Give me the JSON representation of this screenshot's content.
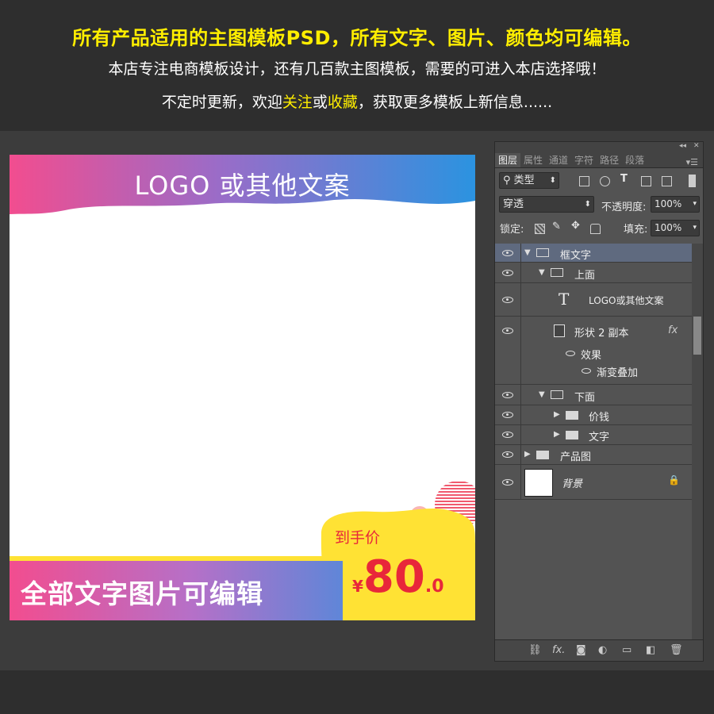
{
  "header": {
    "line1": "所有产品适用的主图模板PSD，所有文字、图片、颜色均可编辑。",
    "line2": "本店专注电商模板设计，还有几百款主图模板，需要的可进入本店选择哦！",
    "line3_pre": "不定时更新，欢迎",
    "line3_hl1": "关注",
    "line3_mid": "或",
    "line3_hl2": "收藏",
    "line3_post": "，获取更多模板上新信息......"
  },
  "canvas": {
    "logo_text": "LOGO 或其他文案",
    "edit_text": "全部文字图片可编辑",
    "price_label": "到手价",
    "currency": "¥",
    "price_int": "80",
    "price_dec": ".0"
  },
  "panel": {
    "tabs": [
      "图层",
      "属性",
      "通道",
      "字符",
      "路径",
      "段落"
    ],
    "filter_label": "类型",
    "blend_mode": "穿透",
    "opacity_label": "不透明度:",
    "opacity_value": "100%",
    "lock_label": "锁定:",
    "fill_label": "填充:",
    "fill_value": "100%",
    "layers": {
      "l0": "框文字",
      "l1": "上面",
      "l2": "LOGO或其他文案",
      "l3": "形状 2 副本",
      "l3_fx": "fx",
      "l4": "效果",
      "l5": "渐变叠加",
      "l6": "下面",
      "l7": "价钱",
      "l8": "文字",
      "l9": "产品图",
      "l10": "背景"
    }
  },
  "colors": {
    "accent_yellow": "#ffee00",
    "price_red": "#e8273a",
    "gradient_pink": "#f24d8f",
    "gradient_blue": "#2b93e0",
    "badge_yellow": "#ffe234"
  }
}
